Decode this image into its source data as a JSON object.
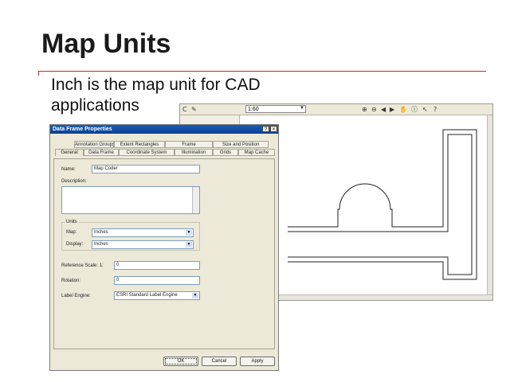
{
  "slide": {
    "title": "Map Units",
    "bullet": "Inch is the map unit for CAD applications"
  },
  "cad_window": {
    "scale_value": "1:60",
    "toolbar_icons": [
      "C",
      "✎",
      "⊕",
      "⊖",
      "◀",
      "▶",
      "✋",
      "ⓘ",
      "↖",
      "?"
    ]
  },
  "dialog": {
    "title": "Data Frame Properties",
    "help_glyph": "?",
    "close_glyph": "×",
    "tabs_row1": [
      "Annotation Groups",
      "Extent Rectangles",
      "Frame",
      "Size and Position"
    ],
    "tabs_row2": [
      "General",
      "Data Frame",
      "Coordinate System",
      "Illumination",
      "Grids",
      "Map Cache"
    ],
    "active_tab": "General",
    "name_label": "Name:",
    "name_value": "Map Coder",
    "description_label": "Description:",
    "units_label": "Units",
    "map_label": "Map:",
    "map_value": "Inches",
    "display_label": "Display:",
    "display_value": "Inches",
    "ref_scale_label": "Reference Scale: 1:",
    "ref_scale_value": "0",
    "rotation_label": "Rotation:",
    "rotation_value": "0",
    "label_engine_label": "Label Engine:",
    "label_engine_value": "ESRI Standard Label Engine",
    "ok": "OK",
    "cancel": "Cancel",
    "apply": "Apply"
  }
}
